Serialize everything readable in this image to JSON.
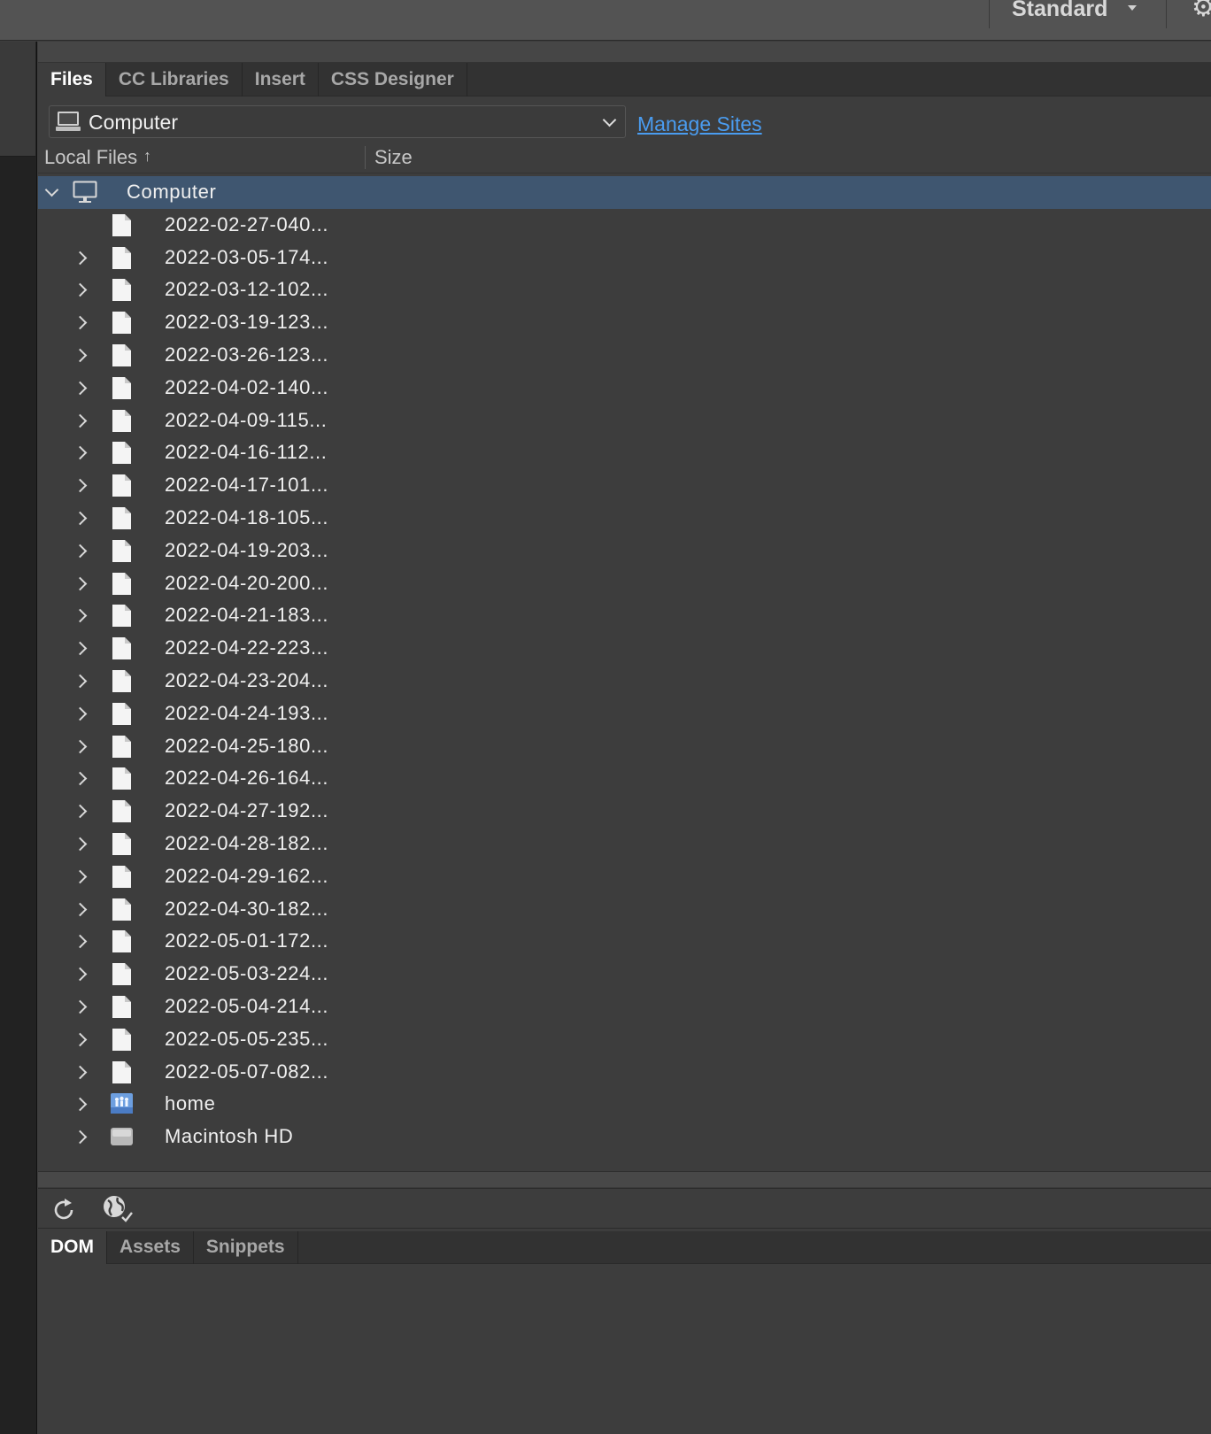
{
  "topbar": {
    "workspace_label": "Standard"
  },
  "tabs": [
    {
      "label": "Files",
      "active": true
    },
    {
      "label": "CC Libraries",
      "active": false
    },
    {
      "label": "Insert",
      "active": false
    },
    {
      "label": "CSS Designer",
      "active": false
    }
  ],
  "site_select": {
    "value": "Computer"
  },
  "manage_sites": "Manage Sites",
  "columns": {
    "local": "Local Files",
    "size": "Size"
  },
  "tree": {
    "root": "Computer",
    "items": [
      {
        "label": "2022-02-27-040...",
        "expandable": false,
        "type": "file"
      },
      {
        "label": "2022-03-05-174...",
        "expandable": true,
        "type": "file"
      },
      {
        "label": "2022-03-12-102...",
        "expandable": true,
        "type": "file"
      },
      {
        "label": "2022-03-19-123...",
        "expandable": true,
        "type": "file"
      },
      {
        "label": "2022-03-26-123...",
        "expandable": true,
        "type": "file"
      },
      {
        "label": "2022-04-02-140...",
        "expandable": true,
        "type": "file"
      },
      {
        "label": "2022-04-09-115...",
        "expandable": true,
        "type": "file"
      },
      {
        "label": "2022-04-16-112...",
        "expandable": true,
        "type": "file"
      },
      {
        "label": "2022-04-17-101...",
        "expandable": true,
        "type": "file"
      },
      {
        "label": "2022-04-18-105...",
        "expandable": true,
        "type": "file"
      },
      {
        "label": "2022-04-19-203...",
        "expandable": true,
        "type": "file"
      },
      {
        "label": "2022-04-20-200...",
        "expandable": true,
        "type": "file"
      },
      {
        "label": "2022-04-21-183...",
        "expandable": true,
        "type": "file"
      },
      {
        "label": "2022-04-22-223...",
        "expandable": true,
        "type": "file"
      },
      {
        "label": "2022-04-23-204...",
        "expandable": true,
        "type": "file"
      },
      {
        "label": "2022-04-24-193...",
        "expandable": true,
        "type": "file"
      },
      {
        "label": "2022-04-25-180...",
        "expandable": true,
        "type": "file"
      },
      {
        "label": "2022-04-26-164...",
        "expandable": true,
        "type": "file"
      },
      {
        "label": "2022-04-27-192...",
        "expandable": true,
        "type": "file"
      },
      {
        "label": "2022-04-28-182...",
        "expandable": true,
        "type": "file"
      },
      {
        "label": "2022-04-29-162...",
        "expandable": true,
        "type": "file"
      },
      {
        "label": "2022-04-30-182...",
        "expandable": true,
        "type": "file"
      },
      {
        "label": "2022-05-01-172...",
        "expandable": true,
        "type": "file"
      },
      {
        "label": "2022-05-03-224...",
        "expandable": true,
        "type": "file"
      },
      {
        "label": "2022-05-04-214...",
        "expandable": true,
        "type": "file"
      },
      {
        "label": "2022-05-05-235...",
        "expandable": true,
        "type": "file"
      },
      {
        "label": "2022-05-07-082...",
        "expandable": true,
        "type": "file"
      },
      {
        "label": "home",
        "expandable": true,
        "type": "home"
      },
      {
        "label": "Macintosh HD",
        "expandable": true,
        "type": "disk"
      }
    ]
  },
  "bottom_tabs": [
    {
      "label": "DOM",
      "active": true
    },
    {
      "label": "Assets",
      "active": false
    },
    {
      "label": "Snippets",
      "active": false
    }
  ],
  "colors": {
    "accent_link": "#4a9cf0",
    "selection": "#3f5670",
    "panel_bg": "#3d3d3d"
  }
}
